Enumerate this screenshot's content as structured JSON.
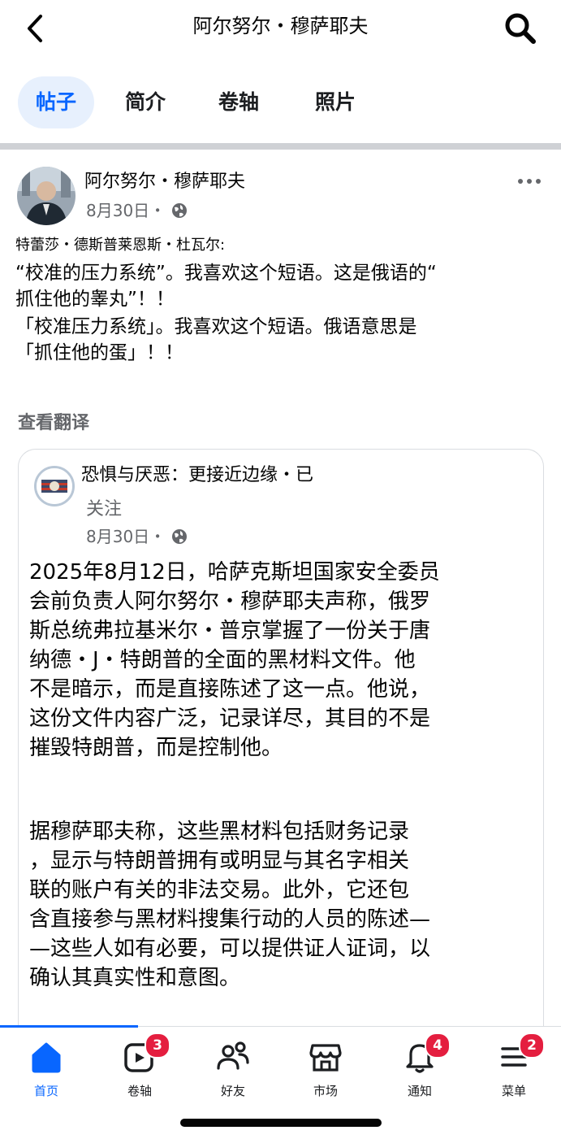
{
  "header": {
    "title": "阿尔努尔・穆萨耶夫",
    "back_icon": "chevron-left-icon",
    "search_icon": "search-icon"
  },
  "tabs": [
    {
      "label": "帖子",
      "active": true
    },
    {
      "label": "简介",
      "active": false
    },
    {
      "label": "卷轴",
      "active": false
    },
    {
      "label": "照片",
      "active": false
    }
  ],
  "post": {
    "author": "阿尔努尔・穆萨耶夫",
    "date": "8月30日・",
    "commenter": "特蕾莎・德斯普莱恩斯・杜瓦尔:",
    "lines": [
      "“校准的压力系统”。我喜欢这个短语。这是俄语的“",
      "抓住他的睾丸”！！",
      "「校准压力系统」。我喜欢这个短语。俄语意思是",
      "「抓住他的蛋」！！"
    ],
    "see_translation": "查看翻译"
  },
  "shared": {
    "page_name": "恐惧与厌恶：更接近边缘・已",
    "follow": "关注",
    "date": "8月30日・",
    "para1": [
      "2025年8月12日，哈萨克斯坦国家安全委员",
      "会前负责人阿尔努尔・穆萨耶夫声称，俄罗",
      "斯总统弗拉基米尔・普京掌握了一份关于唐",
      "纳德・J・特朗普的全面的黑材料文件。他",
      "不是暗示，而是直接陈述了这一点。他说，",
      "这份文件内容广泛，记录详尽，其目的不是",
      "摧毁特朗普，而是控制他。"
    ],
    "para2": [
      "据穆萨耶夫称，这些黑材料包括财务记录",
      "，显示与特朗普拥有或明显与其名字相关",
      "联的账户有关的非法交易。此外，它还包",
      "含直接参与黑材料搜集行动的人员的陈述—",
      "—这些人如有必要，可以提供证人证词，以",
      "确认其真实性和意图。"
    ]
  },
  "nav": [
    {
      "label": "首页",
      "icon": "home-icon",
      "badge": "",
      "active": true
    },
    {
      "label": "卷轴",
      "icon": "reels-icon",
      "badge": "3",
      "active": false
    },
    {
      "label": "好友",
      "icon": "friends-icon",
      "badge": "",
      "active": false
    },
    {
      "label": "市场",
      "icon": "marketplace-icon",
      "badge": "",
      "active": false
    },
    {
      "label": "通知",
      "icon": "bell-icon",
      "badge": "4",
      "active": false
    },
    {
      "label": "菜单",
      "icon": "menu-icon",
      "badge": "2",
      "active": false
    }
  ],
  "colors": {
    "accent": "#0866ff",
    "badge": "#e41e3f",
    "secondary_text": "#65676b"
  }
}
